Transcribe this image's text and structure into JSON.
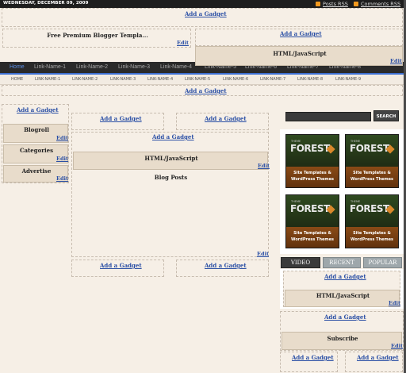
{
  "topbar": {
    "date": "WEDNESDAY, DECEMBER 09, 2009",
    "posts_rss": "Posts RSS",
    "comments_rss": "Comments RSS",
    "rss_color": "#f39a1e"
  },
  "header": {
    "add_gadget_top": "Add a Gadget",
    "title_widget": "Free Premium Blogger Templa...",
    "title_edit": "Edit",
    "add_gadget_right": "Add a Gadget",
    "html_widget_title": "HTML/JavaScript",
    "html_widget_edit": "Edit"
  },
  "nav_primary": {
    "items": [
      "Home",
      "Link-Name-1",
      "Link-Name-2",
      "Link-Name-3",
      "Link-Name-4",
      "Link-Name-5",
      "Link-Name-6",
      "Link-Name-7",
      "Link-Name-8"
    ],
    "active_color": "#5a8ee6"
  },
  "nav_secondary": {
    "items": [
      "HOME",
      "LINK-NAME-1",
      "LINK-NAME-2",
      "LINK-NAME-3",
      "LINK-NAME-4",
      "LINK-NAME-5",
      "LINK-NAME-6",
      "LINK-NAME-7",
      "LINK-NAME-8",
      "LINK-NAME-9"
    ]
  },
  "below_nav": {
    "add_gadget": "Add a Gadget"
  },
  "left_sidebar": {
    "add_gadget": "Add a Gadget",
    "widgets": [
      {
        "title": "Blogroll",
        "edit": "Edit"
      },
      {
        "title": "Categories",
        "edit": "Edit"
      },
      {
        "title": "Advertise",
        "edit": "Edit"
      }
    ]
  },
  "main": {
    "add_gadget_left": "Add a Gadget",
    "add_gadget_right": "Add a Gadget",
    "add_gadget_center": "Add a Gadget",
    "html_widget_title": "HTML/JavaScript",
    "html_widget_edit": "Edit",
    "blog_posts_title": "Blog Posts",
    "blog_posts_edit": "Edit",
    "bottom_add_left": "Add a Gadget",
    "bottom_add_right": "Add a Gadget"
  },
  "right_sidebar": {
    "search_button": "SEARCH",
    "ads": [
      {
        "small": "THEME",
        "brand": "FOREST",
        "line1": "Site Templates &",
        "line2": "WordPress Themes"
      },
      {
        "small": "THEME",
        "brand": "FOREST",
        "line1": "Site Templates &",
        "line2": "WordPress Themes"
      },
      {
        "small": "THEME",
        "brand": "FOREST",
        "line1": "Site Templates &",
        "line2": "WordPress Themes"
      },
      {
        "small": "THEME",
        "brand": "FOREST",
        "line1": "Site Templates &",
        "line2": "WordPress Themes"
      }
    ],
    "tabs": [
      "VIDEO",
      "RECENT",
      "POPULAR"
    ],
    "add_gadget_1": "Add a Gadget",
    "html_widget_title": "HTML/JavaScript",
    "html_widget_edit": "Edit",
    "add_gadget_2": "Add a Gadget",
    "subscribe_title": "Subscribe",
    "subscribe_edit": "Edit",
    "bottom_add_left": "Add a Gadget",
    "bottom_add_right": "Add a Gadget"
  }
}
